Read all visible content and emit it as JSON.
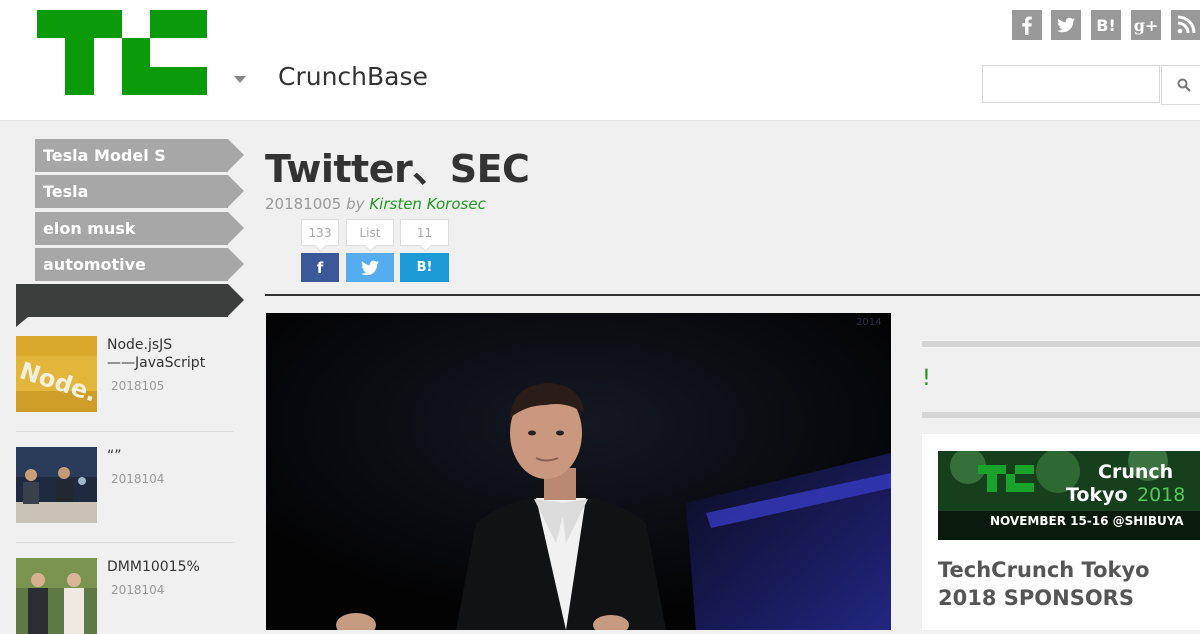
{
  "header": {
    "brand": "TC",
    "crunchbase_label": "CrunchBase",
    "social": [
      {
        "name": "facebook",
        "glyph": "f"
      },
      {
        "name": "twitter",
        "glyph": ""
      },
      {
        "name": "hatena",
        "glyph": "B!"
      },
      {
        "name": "google-plus",
        "glyph": "g+"
      },
      {
        "name": "rss",
        "glyph": ""
      }
    ],
    "search_placeholder": ""
  },
  "sidebar": {
    "tags": [
      "Tesla Model S",
      "Tesla",
      "elon musk",
      "automotive"
    ],
    "related": [
      {
        "title_line1": "Node.jsJS",
        "title_line2": "——JavaScript",
        "date": "2018105"
      },
      {
        "title_line1": "“”",
        "title_line2": "",
        "date": "2018104"
      },
      {
        "title_line1": "DMM10015%",
        "title_line2": "",
        "date": "2018104"
      }
    ]
  },
  "article": {
    "title": "Twitter、SEC",
    "date": "20181005",
    "by": "by",
    "author": "Kirsten Korosec",
    "counts": {
      "facebook": "133",
      "twitter": "List",
      "hatena": "11"
    },
    "share": {
      "facebook": "f",
      "twitter": "",
      "hatena": "B!"
    }
  },
  "right_column": {
    "label": "",
    "excl": "!",
    "promo_banner": {
      "line1": "Crunch",
      "line2": "Tokyo",
      "year": "2018",
      "event": "NOVEMBER 15-16 @SHIBUYA"
    },
    "promo_title": "TechCrunch Tokyo 2018 SPONSORS"
  },
  "colors": {
    "brand_green": "#0a9a0a",
    "author_green": "#1b9a1b",
    "facebook": "#3b5998",
    "twitter": "#55acee",
    "hatena": "#1b9ad6",
    "tag_gray": "#a7a7a7",
    "dark_bar": "#3b3e3c"
  }
}
